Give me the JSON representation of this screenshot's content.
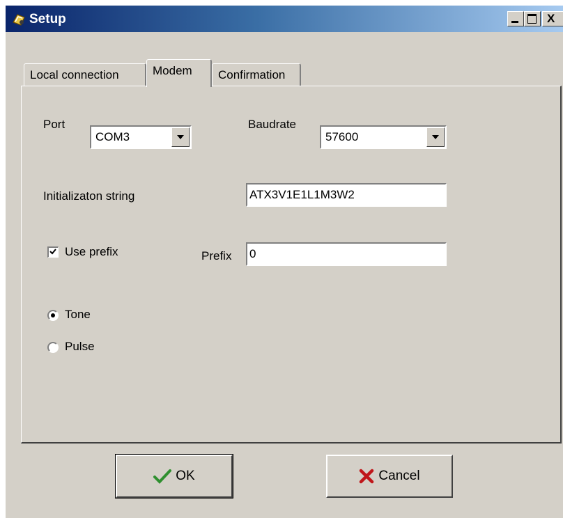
{
  "window": {
    "title": "Setup",
    "close_glyph": "X"
  },
  "tabs": [
    {
      "label": "Local connection"
    },
    {
      "label": "Modem"
    },
    {
      "label": "Confirmation"
    }
  ],
  "modem": {
    "port_label": "Port",
    "port_value": "COM3",
    "baud_label": "Baudrate",
    "baud_value": "57600",
    "init_label": "Initializaton string",
    "init_value": "ATX3V1E1L1M3W2",
    "use_prefix_label": "Use prefix",
    "use_prefix_checked": true,
    "prefix_label": "Prefix",
    "prefix_value": "0",
    "dial_tone_label": "Tone",
    "dial_pulse_label": "Pulse",
    "dial_selected": "Tone"
  },
  "buttons": {
    "ok_label": "OK",
    "cancel_label": "Cancel"
  },
  "colors": {
    "titlebar_start": "#0a246a",
    "titlebar_end": "#a6caf0",
    "face": "#d4d0c8",
    "ok_check": "#2f8f2f",
    "cancel_x": "#c0161a"
  }
}
